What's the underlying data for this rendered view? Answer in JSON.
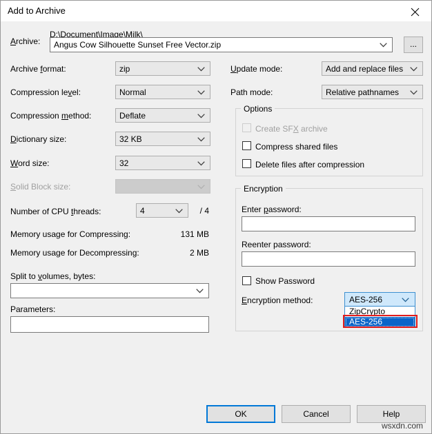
{
  "window": {
    "title": "Add to Archive",
    "close_icon": "close-icon"
  },
  "archive": {
    "label": "Archive:",
    "path_text": "D:\\Document\\Image\\Milk\\",
    "name_value": "Angus Cow Silhouette Sunset Free Vector.zip",
    "browse_label": "..."
  },
  "left_column": {
    "archive_format": {
      "label": "Archive format:",
      "value": "zip"
    },
    "compression_level": {
      "label": "Compression level:",
      "value": "Normal"
    },
    "compression_method": {
      "label": "Compression method:",
      "value": "Deflate"
    },
    "dictionary_size": {
      "label": "Dictionary size:",
      "value": "32 KB"
    },
    "word_size": {
      "label": "Word size:",
      "value": "32"
    },
    "solid_block_size": {
      "label": "Solid Block size:",
      "value": ""
    },
    "cpu_threads": {
      "label": "Number of CPU threads:",
      "value": "4",
      "total": "/ 4"
    },
    "memory_compressing": {
      "label": "Memory usage for Compressing:",
      "value": "131 MB"
    },
    "memory_decompressing": {
      "label": "Memory usage for Decompressing:",
      "value": "2 MB"
    },
    "split_volumes": {
      "label": "Split to volumes, bytes:",
      "value": ""
    },
    "parameters": {
      "label": "Parameters:",
      "value": ""
    }
  },
  "right_column": {
    "update_mode": {
      "label": "Update mode:",
      "value": "Add and replace files"
    },
    "path_mode": {
      "label": "Path mode:",
      "value": "Relative pathnames"
    },
    "options": {
      "title": "Options",
      "items": [
        {
          "label": "Create SFX archive",
          "checked": false,
          "disabled": true
        },
        {
          "label": "Compress shared files",
          "checked": false,
          "disabled": false
        },
        {
          "label": "Delete files after compression",
          "checked": false,
          "disabled": false
        }
      ]
    },
    "encryption": {
      "title": "Encryption",
      "enter_password": {
        "label": "Enter password:",
        "value": ""
      },
      "reenter_password": {
        "label": "Reenter password:",
        "value": ""
      },
      "show_password": {
        "label": "Show Password",
        "checked": false
      },
      "method": {
        "label": "Encryption method:",
        "value": "AES-256",
        "open": true,
        "options": [
          "ZipCrypto",
          "AES-256"
        ],
        "selected_index": 1,
        "highlight_color": "#e01b1b",
        "selection_color": "#0a64c8"
      }
    }
  },
  "buttons": {
    "ok": "OK",
    "cancel": "Cancel",
    "help": "Help"
  },
  "watermark": "wsxdn.com"
}
